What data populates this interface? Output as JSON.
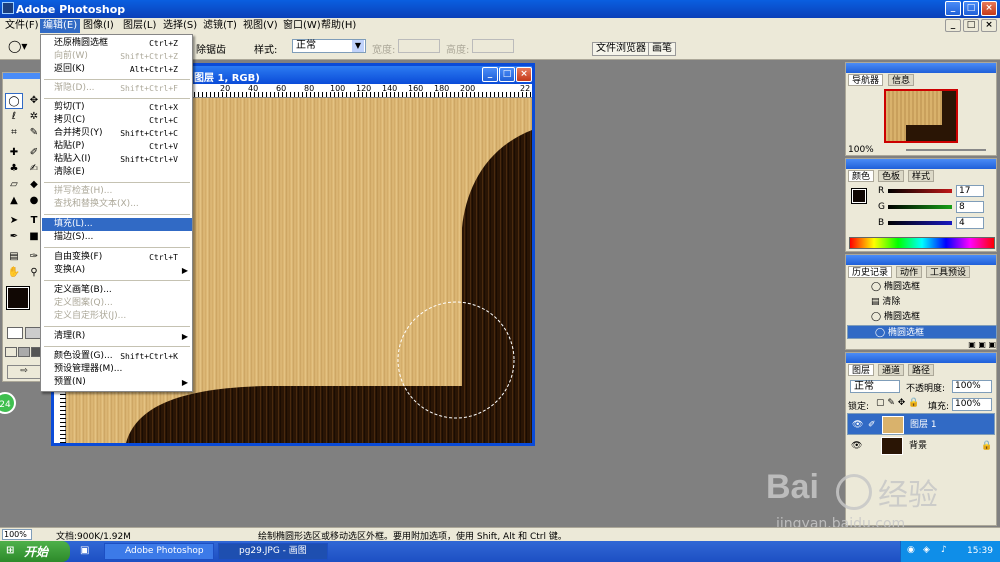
{
  "window": {
    "title": "Adobe Photoshop"
  },
  "menubar": {
    "items": [
      "文件(F)",
      "编辑(E)",
      "图像(I)",
      "图层(L)",
      "选择(S)",
      "滤镜(T)",
      "视图(V)",
      "窗口(W)",
      "帮助(H)"
    ]
  },
  "options": {
    "hidden_partial": "除锯齿",
    "style_label": "样式:",
    "style_value": "正常",
    "width_label": "宽度:",
    "height_label": "高度:",
    "file_browser": "文件浏览器",
    "brushes": "画笔"
  },
  "edit_menu": {
    "items": [
      {
        "label": "还原椭圆选框",
        "shortcut": "Ctrl+Z",
        "disabled": false
      },
      {
        "label": "向前(W)",
        "shortcut": "Shift+Ctrl+Z",
        "disabled": true
      },
      {
        "label": "返回(K)",
        "shortcut": "Alt+Ctrl+Z",
        "disabled": false
      },
      {
        "label": "渐隐(D)...",
        "shortcut": "Shift+Ctrl+F",
        "disabled": true
      },
      {
        "label": "剪切(T)",
        "shortcut": "Ctrl+X",
        "disabled": false
      },
      {
        "label": "拷贝(C)",
        "shortcut": "Ctrl+C",
        "disabled": false
      },
      {
        "label": "合并拷贝(Y)",
        "shortcut": "Shift+Ctrl+C",
        "disabled": false
      },
      {
        "label": "粘贴(P)",
        "shortcut": "Ctrl+V",
        "disabled": false
      },
      {
        "label": "粘贴入(I)",
        "shortcut": "Shift+Ctrl+V",
        "disabled": false
      },
      {
        "label": "清除(E)",
        "shortcut": "",
        "disabled": false
      },
      {
        "label": "拼写检查(H)...",
        "shortcut": "",
        "disabled": true
      },
      {
        "label": "查找和替换文本(X)...",
        "shortcut": "",
        "disabled": true
      },
      {
        "label": "填充(L)...",
        "shortcut": "",
        "disabled": false,
        "highlight": true
      },
      {
        "label": "描边(S)...",
        "shortcut": "",
        "disabled": false
      },
      {
        "label": "自由变换(F)",
        "shortcut": "Ctrl+T",
        "disabled": false
      },
      {
        "label": "变换(A)",
        "shortcut": "",
        "disabled": false,
        "submenu": true
      },
      {
        "label": "定义画笔(B)...",
        "shortcut": "",
        "disabled": false
      },
      {
        "label": "定义图案(Q)...",
        "shortcut": "",
        "disabled": true
      },
      {
        "label": "定义自定形状(J)...",
        "shortcut": "",
        "disabled": true
      },
      {
        "label": "清理(R)",
        "shortcut": "",
        "disabled": false,
        "submenu": true
      },
      {
        "label": "颜色设置(G)...",
        "shortcut": "Shift+Ctrl+K",
        "disabled": false
      },
      {
        "label": "预设管理器(M)...",
        "shortcut": "",
        "disabled": false
      },
      {
        "label": "预置(N)",
        "shortcut": "",
        "disabled": false,
        "submenu": true
      }
    ]
  },
  "document": {
    "title": "图层 1, RGB)",
    "ruler_ticks": [
      "20",
      "40",
      "60",
      "80",
      "100",
      "120",
      "140",
      "160",
      "180",
      "200",
      "22"
    ]
  },
  "navigator": {
    "tabs": [
      "导航器",
      "信息"
    ],
    "zoom": "100%"
  },
  "color_panel": {
    "tabs": [
      "颜色",
      "色板",
      "样式"
    ],
    "channels": [
      {
        "name": "R",
        "value": "17",
        "color": "#c01818"
      },
      {
        "name": "G",
        "value": "8",
        "color": "#18a018"
      },
      {
        "name": "B",
        "value": "4",
        "color": "#1818c0"
      }
    ]
  },
  "history": {
    "tabs": [
      "历史记录",
      "动作",
      "工具预设"
    ],
    "items": [
      "椭圆选框",
      "清除",
      "椭圆选框",
      "椭圆选框"
    ]
  },
  "layers": {
    "tabs": [
      "图层",
      "通道",
      "路径"
    ],
    "blend_mode": "正常",
    "opacity_label": "不透明度:",
    "opacity": "100%",
    "lock_label": "锁定:",
    "fill_label": "填充:",
    "fill": "100%",
    "items": [
      "图层 1",
      "背景"
    ]
  },
  "status": {
    "zoom": "100%",
    "doc_size": "文档:900K/1.92M",
    "hint": "绘制椭圆形选区或移动选区外框。要用附加选项，使用 Shift, Alt 和 Ctrl 键。"
  },
  "taskbar": {
    "start": "开始",
    "items": [
      "Adobe Photoshop",
      "pg29.JPG - 画图"
    ],
    "time": "15:39"
  },
  "watermark": {
    "brand": "Bai",
    "brand2": "经验",
    "url": "jingyan.baidu.com"
  },
  "colors": {
    "selection_blue": "#316ac5",
    "xp_blue": "#0a4bd8",
    "dark_wood": "#2a1505",
    "light_wood": "#d9b26c"
  }
}
